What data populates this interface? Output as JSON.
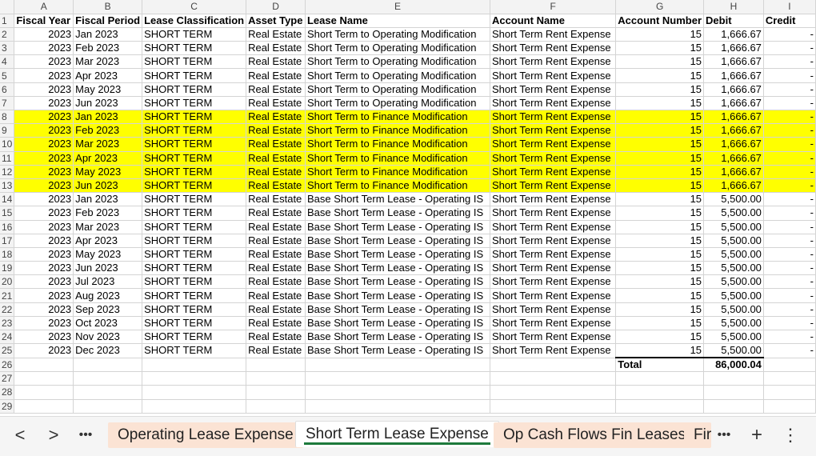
{
  "columns": [
    "A",
    "B",
    "C",
    "D",
    "E",
    "F",
    "G",
    "H",
    "I"
  ],
  "headers": [
    "Fiscal Year",
    "Fiscal Period",
    "Lease Classification",
    "Asset Type",
    "Lease Name",
    "Account Name",
    "Account Number",
    "Debit",
    "Credit"
  ],
  "rows": [
    [
      "2023",
      "Jan 2023",
      "SHORT TERM",
      "Real Estate",
      "Short Term to Operating Modification",
      "Short Term Rent Expense",
      "15",
      "1,666.67",
      "-"
    ],
    [
      "2023",
      "Feb 2023",
      "SHORT TERM",
      "Real Estate",
      "Short Term to Operating Modification",
      "Short Term Rent Expense",
      "15",
      "1,666.67",
      "-"
    ],
    [
      "2023",
      "Mar 2023",
      "SHORT TERM",
      "Real Estate",
      "Short Term to Operating Modification",
      "Short Term Rent Expense",
      "15",
      "1,666.67",
      "-"
    ],
    [
      "2023",
      "Apr 2023",
      "SHORT TERM",
      "Real Estate",
      "Short Term to Operating Modification",
      "Short Term Rent Expense",
      "15",
      "1,666.67",
      "-"
    ],
    [
      "2023",
      "May 2023",
      "SHORT TERM",
      "Real Estate",
      "Short Term to Operating Modification",
      "Short Term Rent Expense",
      "15",
      "1,666.67",
      "-"
    ],
    [
      "2023",
      "Jun 2023",
      "SHORT TERM",
      "Real Estate",
      "Short Term to Operating Modification",
      "Short Term Rent Expense",
      "15",
      "1,666.67",
      "-"
    ],
    [
      "2023",
      "Jan 2023",
      "SHORT TERM",
      "Real Estate",
      "Short Term to Finance Modification",
      "Short Term Rent Expense",
      "15",
      "1,666.67",
      "-"
    ],
    [
      "2023",
      "Feb 2023",
      "SHORT TERM",
      "Real Estate",
      "Short Term to Finance Modification",
      "Short Term Rent Expense",
      "15",
      "1,666.67",
      "-"
    ],
    [
      "2023",
      "Mar 2023",
      "SHORT TERM",
      "Real Estate",
      "Short Term to Finance Modification",
      "Short Term Rent Expense",
      "15",
      "1,666.67",
      "-"
    ],
    [
      "2023",
      "Apr 2023",
      "SHORT TERM",
      "Real Estate",
      "Short Term to Finance Modification",
      "Short Term Rent Expense",
      "15",
      "1,666.67",
      "-"
    ],
    [
      "2023",
      "May 2023",
      "SHORT TERM",
      "Real Estate",
      "Short Term to Finance Modification",
      "Short Term Rent Expense",
      "15",
      "1,666.67",
      "-"
    ],
    [
      "2023",
      "Jun 2023",
      "SHORT TERM",
      "Real Estate",
      "Short Term to Finance Modification",
      "Short Term Rent Expense",
      "15",
      "1,666.67",
      "-"
    ],
    [
      "2023",
      "Jan 2023",
      "SHORT TERM",
      "Real Estate",
      "Base Short Term Lease - Operating IS",
      "Short Term Rent Expense",
      "15",
      "5,500.00",
      "-"
    ],
    [
      "2023",
      "Feb 2023",
      "SHORT TERM",
      "Real Estate",
      "Base Short Term Lease - Operating IS",
      "Short Term Rent Expense",
      "15",
      "5,500.00",
      "-"
    ],
    [
      "2023",
      "Mar 2023",
      "SHORT TERM",
      "Real Estate",
      "Base Short Term Lease - Operating IS",
      "Short Term Rent Expense",
      "15",
      "5,500.00",
      "-"
    ],
    [
      "2023",
      "Apr 2023",
      "SHORT TERM",
      "Real Estate",
      "Base Short Term Lease - Operating IS",
      "Short Term Rent Expense",
      "15",
      "5,500.00",
      "-"
    ],
    [
      "2023",
      "May 2023",
      "SHORT TERM",
      "Real Estate",
      "Base Short Term Lease - Operating IS",
      "Short Term Rent Expense",
      "15",
      "5,500.00",
      "-"
    ],
    [
      "2023",
      "Jun 2023",
      "SHORT TERM",
      "Real Estate",
      "Base Short Term Lease - Operating IS",
      "Short Term Rent Expense",
      "15",
      "5,500.00",
      "-"
    ],
    [
      "2023",
      "Jul 2023",
      "SHORT TERM",
      "Real Estate",
      "Base Short Term Lease - Operating IS",
      "Short Term Rent Expense",
      "15",
      "5,500.00",
      "-"
    ],
    [
      "2023",
      "Aug 2023",
      "SHORT TERM",
      "Real Estate",
      "Base Short Term Lease - Operating IS",
      "Short Term Rent Expense",
      "15",
      "5,500.00",
      "-"
    ],
    [
      "2023",
      "Sep 2023",
      "SHORT TERM",
      "Real Estate",
      "Base Short Term Lease - Operating IS",
      "Short Term Rent Expense",
      "15",
      "5,500.00",
      "-"
    ],
    [
      "2023",
      "Oct 2023",
      "SHORT TERM",
      "Real Estate",
      "Base Short Term Lease - Operating IS",
      "Short Term Rent Expense",
      "15",
      "5,500.00",
      "-"
    ],
    [
      "2023",
      "Nov 2023",
      "SHORT TERM",
      "Real Estate",
      "Base Short Term Lease - Operating IS",
      "Short Term Rent Expense",
      "15",
      "5,500.00",
      "-"
    ],
    [
      "2023",
      "Dec 2023",
      "SHORT TERM",
      "Real Estate",
      "Base Short Term Lease - Operating IS",
      "Short Term Rent Expense",
      "15",
      "5,500.00",
      "-"
    ]
  ],
  "highlighted_rows": [
    8,
    9,
    10,
    11,
    12,
    13
  ],
  "highlight_color": "#ffff00",
  "total": {
    "label": "Total",
    "value": "86,000.04"
  },
  "blank_rows": [
    27,
    28,
    29
  ],
  "tabs": {
    "prev_icon": "<",
    "next_icon": ">",
    "more_icon": "•••",
    "add_icon": "+",
    "menu_icon": "⋮",
    "items": [
      {
        "label": "Operating Lease Expense",
        "active": false
      },
      {
        "label": "Short Term Lease Expense",
        "active": true
      },
      {
        "label": "Op Cash Flows Fin Leases",
        "active": false
      },
      {
        "label": "Fir",
        "active": false
      }
    ],
    "active_underline_color": "#1e7a3c",
    "inactive_tab_color": "#fbe3d4"
  }
}
